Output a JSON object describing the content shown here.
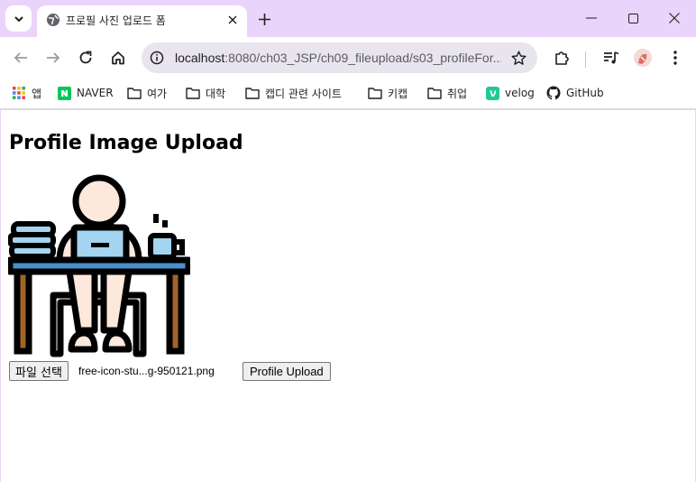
{
  "browser": {
    "tab": {
      "title": "프로필 사진 업로드 폼"
    },
    "address_bar": {
      "url_host": "localhost",
      "url_rest": ":8080/ch03_JSP/ch09_fileupload/s03_profileFor..."
    },
    "bookmarks": [
      {
        "label": "앱",
        "icon": "apps-grid-icon"
      },
      {
        "label": "NAVER",
        "icon": "naver-icon"
      },
      {
        "label": "여가",
        "icon": "folder-icon"
      },
      {
        "label": "대학",
        "icon": "folder-icon"
      },
      {
        "label": "캡디 관련 사이트",
        "icon": "folder-icon"
      },
      {
        "label": "키캡",
        "icon": "folder-icon"
      },
      {
        "label": "취업",
        "icon": "folder-icon"
      },
      {
        "label": "velog",
        "icon": "velog-icon"
      },
      {
        "label": "GitHub",
        "icon": "github-icon"
      }
    ],
    "colors": {
      "frame": "#e9d4fb",
      "naver": "#03c75a",
      "velog": "#20c997"
    }
  },
  "page": {
    "heading": "Profile Image Upload",
    "image_alt": "person working at laptop illustration",
    "file_button_label": "파일 선택",
    "selected_file": "free-icon-stu...g-950121.png",
    "upload_button_label": "Profile Upload"
  }
}
